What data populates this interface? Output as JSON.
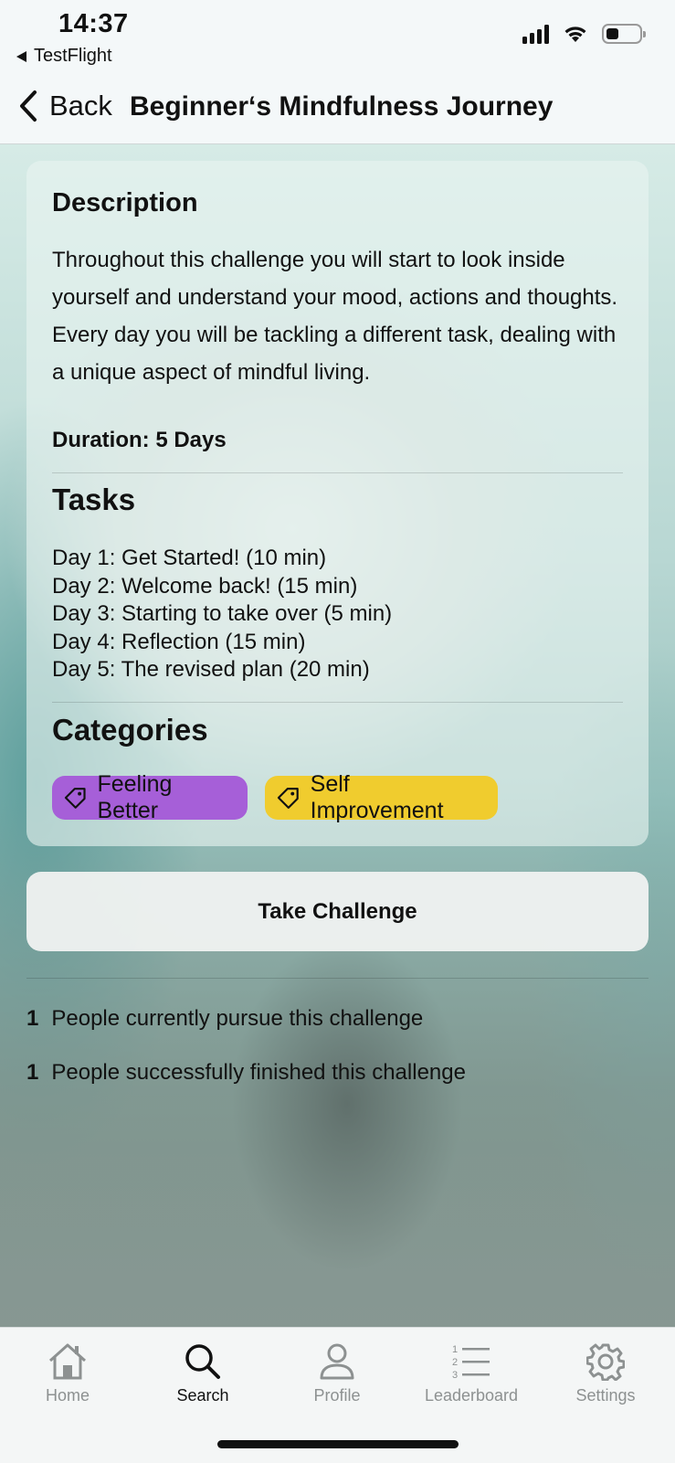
{
  "status_bar": {
    "time": "14:37",
    "back_app": "TestFlight"
  },
  "nav": {
    "back_label": "Back",
    "title": "Beginner‘s Mindfulness Journey"
  },
  "card": {
    "description_heading": "Description",
    "description_text": "Throughout this challenge you will start to look inside yourself and understand your mood, actions and thoughts. Every day you will be tackling a different task, dealing with a unique aspect of mindful living.",
    "duration": "Duration: 5 Days",
    "tasks_heading": "Tasks",
    "tasks": [
      "Day 1: Get Started! (10 min)",
      "Day 2: Welcome back! (15 min)",
      "Day 3: Starting to take over (5 min)",
      "Day 4: Reflection (15 min)",
      "Day 5: The revised plan (20 min)"
    ],
    "categories_heading": "Categories",
    "categories": [
      {
        "label": "Feeling Better",
        "color": "#a65fd8",
        "icon": "tag-icon"
      },
      {
        "label": "Self Improvement",
        "color": "#f0cc2e",
        "icon": "tag-icon"
      }
    ]
  },
  "take_challenge_label": "Take Challenge",
  "stats": [
    {
      "count": "1",
      "text": "People currently pursue this challenge"
    },
    {
      "count": "1",
      "text": "People successfully finished this challenge"
    }
  ],
  "tabs": [
    {
      "label": "Home",
      "icon": "home-icon",
      "active": false
    },
    {
      "label": "Search",
      "icon": "search-icon",
      "active": true
    },
    {
      "label": "Profile",
      "icon": "person-icon",
      "active": false
    },
    {
      "label": "Leaderboard",
      "icon": "list-icon",
      "active": false
    },
    {
      "label": "Settings",
      "icon": "gear-icon",
      "active": false
    }
  ]
}
